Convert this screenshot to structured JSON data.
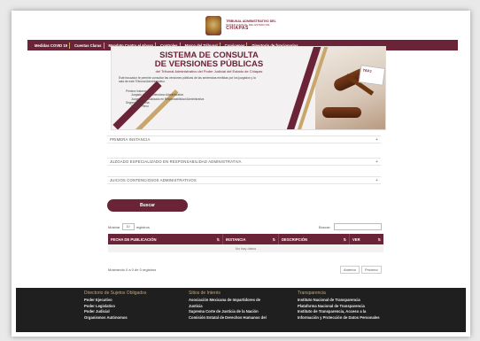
{
  "header": {
    "logo_line1": "TRIBUNAL ADMINISTRATIVO DEL",
    "logo_line2": "PODER JUDICIAL DEL ESTADO DE",
    "logo_line3": "CHIAPAS"
  },
  "nav": {
    "items": [
      "Medidas COVID 19",
      "Cuentas Claras",
      "Mandato Contra el Abuso",
      "Controles",
      "Marco del Tribunal",
      "Conócenos",
      "Directorio de funcionarios"
    ]
  },
  "banner": {
    "title1": "SISTEMA DE CONSULTA",
    "title2": "DE VERSIONES PÚBLICAS",
    "subtitle": "del Tribunal Administrativo del Poder Judicial del Estado de Chiapas",
    "description": "Este buscador te permite consultar las versiones públicas de las sentencias emitidas por los juzgados y la sala de este Tribunal Administrativo.",
    "list_title": "Primera Instancia:",
    "list_items": [
      "Juzgado de lo Contencioso Administrativo",
      "Juzgado Especializado en Responsabilidad Administrativa",
      "Segunda Instancia:",
      "Sala en Pleno"
    ],
    "card_label": "TAPJ"
  },
  "accordions": [
    "PRIMERA INSTANCIA",
    "JUZGADO ESPECIALIZADO EN RESPONSABILIDAD ADMINISTRATIVA",
    "JUICIOS CONTENCIOSOS ADMINISTRATIVOS"
  ],
  "search_button": "Buscar",
  "table_controls": {
    "show_prefix": "Mostrar",
    "show_value": "10",
    "show_suffix": "registros",
    "search_label": "Buscar:"
  },
  "table": {
    "columns": [
      "FECHA DE PUBLICACIÓN",
      "INSTANCIA",
      "DESCRIPCIÓN",
      "VER"
    ],
    "empty_text": "No hay datos",
    "info": "Mostrando 0 a 0 de 0 registros",
    "prev": "Anterior",
    "next": "Próximo"
  },
  "footer": {
    "columns": [
      {
        "heading": "Directorio de Sujetos Obligados",
        "items": [
          "Poder Ejecutivo",
          "Poder Legislativo",
          "Poder Judicial",
          "Organismos Autónomos"
        ]
      },
      {
        "heading": "Sitios de Interés",
        "items": [
          "Asociación Mexicana de Impartidores de",
          "Justicia",
          "Suprema Corte de Justicia de la Nación",
          "Comisión Estatal de Derechos Humanos del"
        ]
      },
      {
        "heading": "Transparencia",
        "items": [
          "Instituto Nacional de Transparencia",
          "Plataforma Nacional de Transparencia",
          "Instituto de Transparencia, Acceso a la",
          "Información y Protección de Datos Personales"
        ]
      }
    ]
  },
  "colors": {
    "primary": "#6b2338",
    "accent": "#c9a66b",
    "footer": "#1f1f1f"
  }
}
